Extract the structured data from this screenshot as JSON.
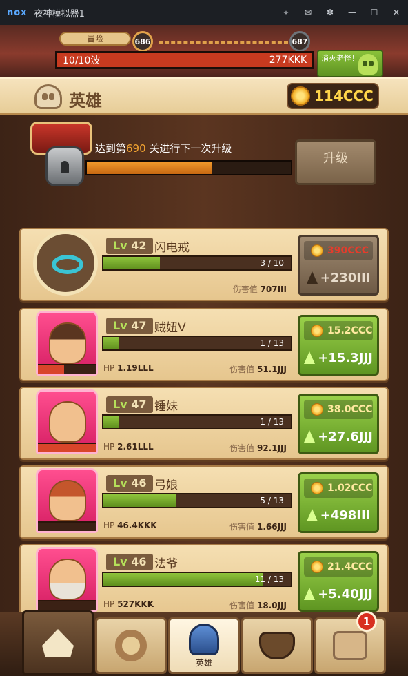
{
  "window": {
    "logo": "nox",
    "title": "夜神模拟器1"
  },
  "topbar": {
    "mode": "冒险",
    "current_level": "686",
    "next_level": "687",
    "wave": "10/10波",
    "enemy_hp": "277KKK",
    "boss_button": "消灭老怪！",
    "wave_fill_pct": 100
  },
  "header": {
    "title": "英雄",
    "gold": "114CCC"
  },
  "unlock": {
    "text_prefix": "达到第",
    "level": "690",
    "text_suffix": " 关进行下一次升级",
    "button": "升级",
    "progress_pct": 61
  },
  "cards": [
    {
      "type": "ring",
      "lv_label": "Lv",
      "level": "42",
      "name": "闪电戒",
      "count": "3 / 10",
      "fill_pct": 30,
      "hp_label": "",
      "hp": "",
      "dmg_label": "伤害值",
      "dmg": "707III",
      "cost": "390CCC",
      "gain": "+230III",
      "affordable": false
    },
    {
      "type": "hero",
      "lv_label": "Lv",
      "level": "47",
      "name": "贼妞V",
      "count": "1 / 13",
      "fill_pct": 8,
      "hp_label": "HP",
      "hp": "1.19LLL",
      "dmg_label": "伤害值",
      "dmg": "51.1JJJ",
      "cost": "15.2CCC",
      "gain": "+15.3JJJ",
      "affordable": true,
      "hp_fill_pct": 45
    },
    {
      "type": "hero",
      "lv_label": "Lv",
      "level": "47",
      "name": "锤妹",
      "count": "1 / 13",
      "fill_pct": 8,
      "hp_label": "HP",
      "hp": "2.61LLL",
      "dmg_label": "伤害值",
      "dmg": "92.1JJJ",
      "cost": "38.0CCC",
      "gain": "+27.6JJJ",
      "affordable": true,
      "hp_fill_pct": 100
    },
    {
      "type": "hero",
      "lv_label": "Lv",
      "level": "46",
      "name": "弓娘",
      "count": "5 / 13",
      "fill_pct": 39,
      "hp_label": "HP",
      "hp": "46.4KKK",
      "dmg_label": "伤害值",
      "dmg": "1.66JJJ",
      "cost": "1.02CCC",
      "gain": "+498III",
      "affordable": true,
      "hp_fill_pct": 0
    },
    {
      "type": "hero",
      "lv_label": "Lv",
      "level": "46",
      "name": "法爷",
      "count": "11 / 13",
      "fill_pct": 85,
      "hp_label": "HP",
      "hp": "527KKK",
      "dmg_label": "伤害值",
      "dmg": "18.0JJJ",
      "cost": "21.4CCC",
      "gain": "+5.40JJJ",
      "affordable": true,
      "hp_fill_pct": 0
    }
  ],
  "nav": {
    "items": [
      "home",
      "gear",
      "英雄",
      "pot",
      "chest"
    ],
    "badge": "1"
  }
}
